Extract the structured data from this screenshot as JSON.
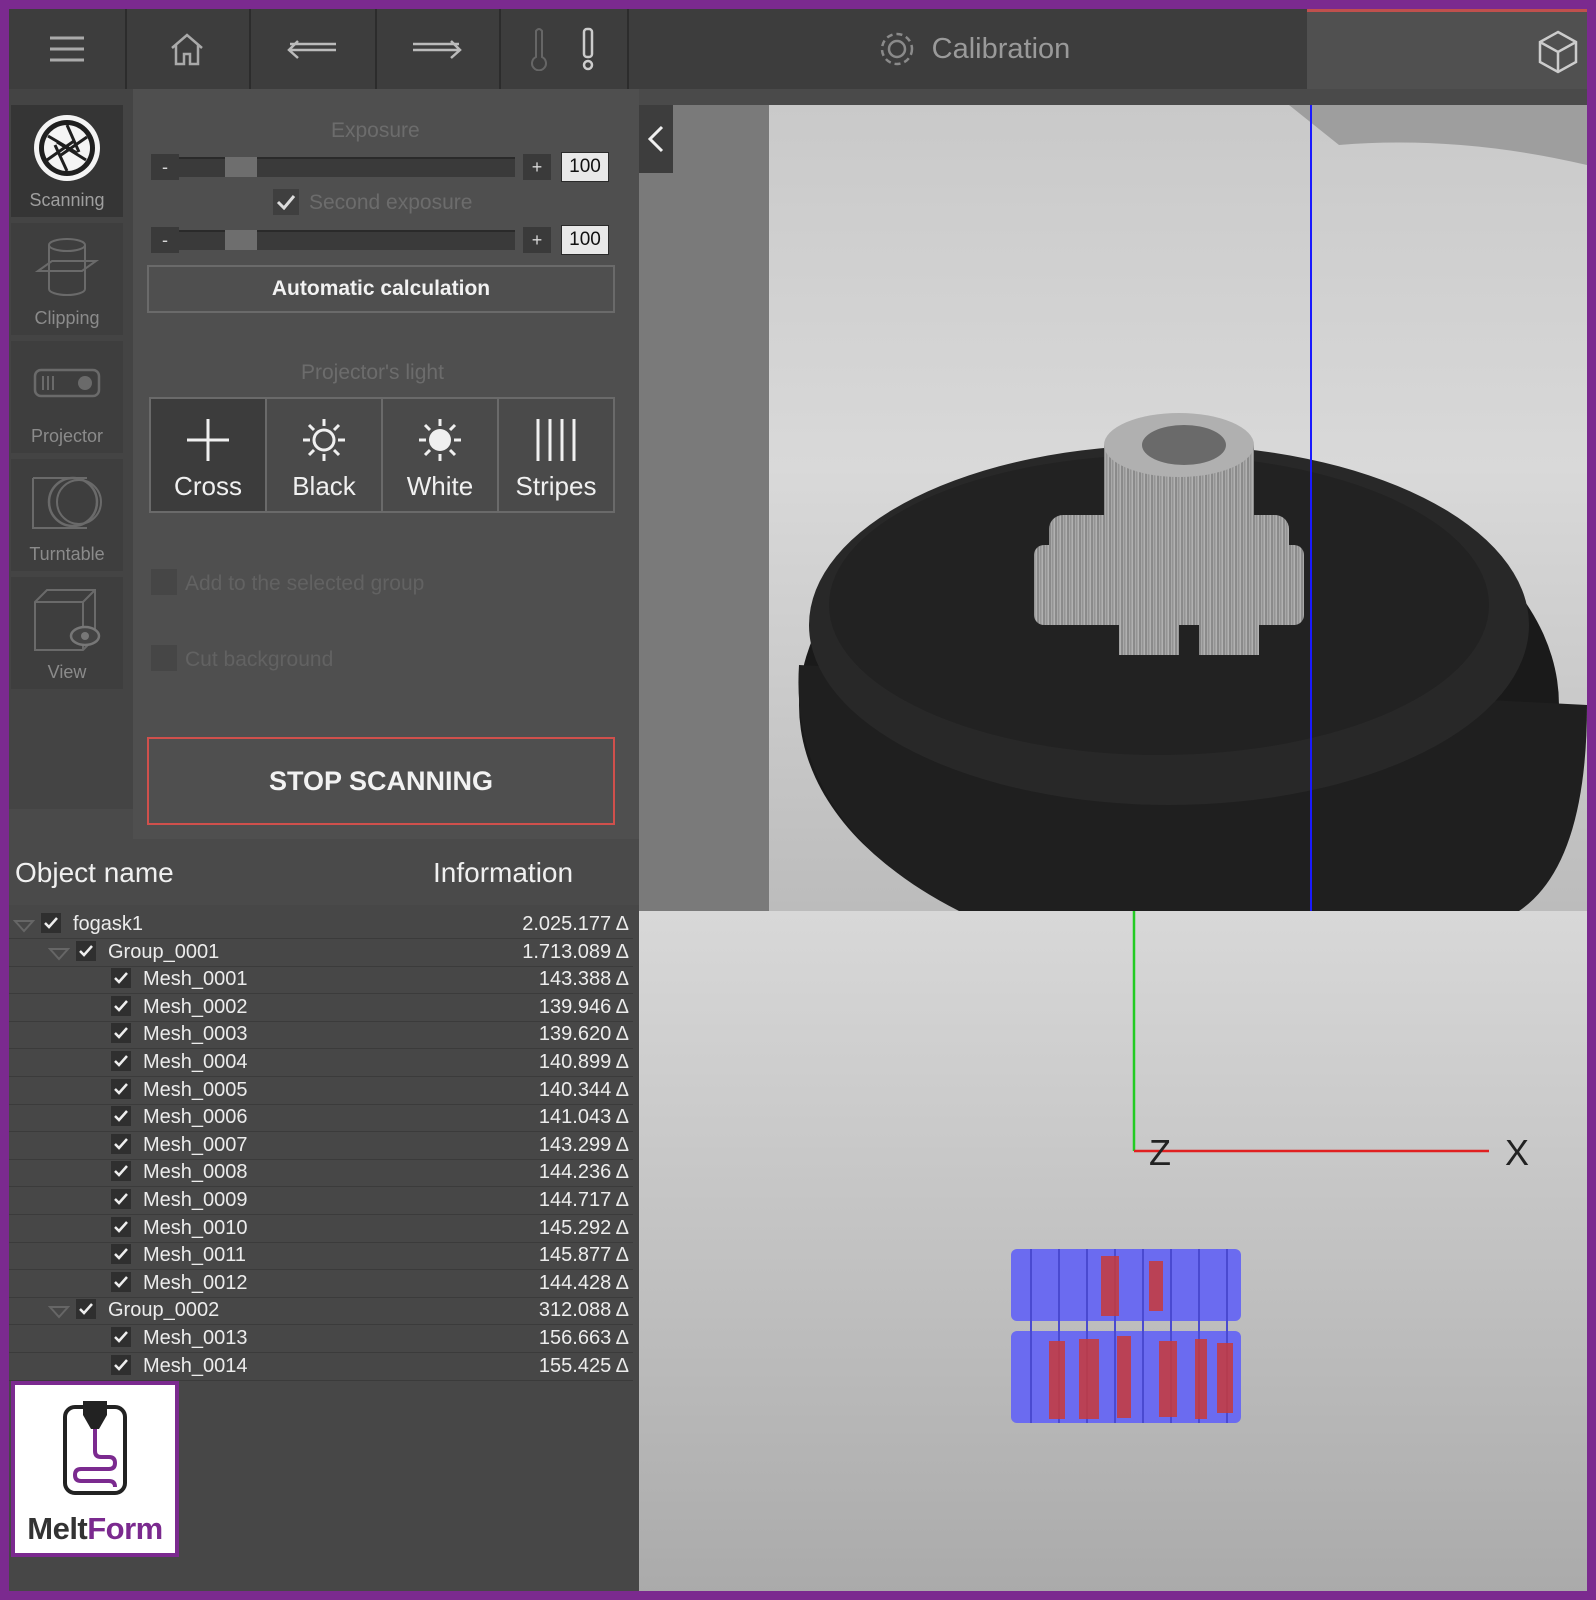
{
  "topbar": {
    "title": "Calibration",
    "icons": [
      "menu-icon",
      "home-icon",
      "undo-icon",
      "redo-icon",
      "thermometer-icon",
      "warning-icon",
      "gear-icon",
      "cube-icon"
    ]
  },
  "sidebar": {
    "items": [
      {
        "label": "Scanning",
        "icon": "aperture-icon"
      },
      {
        "label": "Clipping",
        "icon": "clipping-icon"
      },
      {
        "label": "Projector",
        "icon": "projector-icon"
      },
      {
        "label": "Turntable",
        "icon": "turntable-icon"
      },
      {
        "label": "View",
        "icon": "view-icon"
      }
    ]
  },
  "panel": {
    "exposure_label": "Exposure",
    "minus": "-",
    "plus": "+",
    "exposure_value": "100",
    "exposure_level": 0.15,
    "second_exposure_label": "Second exposure",
    "second_exposure_checked": true,
    "second_exposure_value": "100",
    "second_exposure_level": 0.15,
    "auto_calc_label": "Automatic calculation",
    "projector_light_label": "Projector's light",
    "light_buttons": [
      "Cross",
      "Black",
      "White",
      "Stripes"
    ],
    "add_group_label": "Add to the selected group",
    "cut_background_label": "Cut background",
    "stop_label": "STOP SCANNING"
  },
  "tree": {
    "col_name": "Object name",
    "col_info": "Information",
    "rows": [
      {
        "name": "fogask1",
        "info": "2.025.177 Δ",
        "level": 0,
        "expandable": true
      },
      {
        "name": "Group_0001",
        "info": "1.713.089 Δ",
        "level": 1,
        "expandable": true
      },
      {
        "name": "Mesh_0001",
        "info": "143.388 Δ",
        "level": 2
      },
      {
        "name": "Mesh_0002",
        "info": "139.946 Δ",
        "level": 2
      },
      {
        "name": "Mesh_0003",
        "info": "139.620 Δ",
        "level": 2
      },
      {
        "name": "Mesh_0004",
        "info": "140.899 Δ",
        "level": 2
      },
      {
        "name": "Mesh_0005",
        "info": "140.344 Δ",
        "level": 2
      },
      {
        "name": "Mesh_0006",
        "info": "141.043 Δ",
        "level": 2
      },
      {
        "name": "Mesh_0007",
        "info": "143.299 Δ",
        "level": 2
      },
      {
        "name": "Mesh_0008",
        "info": "144.236 Δ",
        "level": 2
      },
      {
        "name": "Mesh_0009",
        "info": "144.717 Δ",
        "level": 2
      },
      {
        "name": "Mesh_0010",
        "info": "145.292 Δ",
        "level": 2
      },
      {
        "name": "Mesh_0011",
        "info": "145.877 Δ",
        "level": 2
      },
      {
        "name": "Mesh_0012",
        "info": "144.428 Δ",
        "level": 2
      },
      {
        "name": "Group_0002",
        "info": "312.088 Δ",
        "level": 1,
        "expandable": true
      },
      {
        "name": "Mesh_0013",
        "info": "156.663 Δ",
        "level": 2
      },
      {
        "name": "Mesh_0014",
        "info": "155.425 Δ",
        "level": 2
      }
    ]
  },
  "viewer": {
    "axis_z": "Z",
    "axis_x": "X"
  },
  "logo": {
    "part1": "Melt",
    "part2": "Form"
  },
  "colors": {
    "frame": "#7b2a8f",
    "stop_border": "#d0504c",
    "axis_x": "#e02020",
    "axis_y": "#22cc22",
    "scan_line": "#1a1aff",
    "mesh_blue": "#6b6bf0",
    "mesh_red": "#c83a3a"
  }
}
